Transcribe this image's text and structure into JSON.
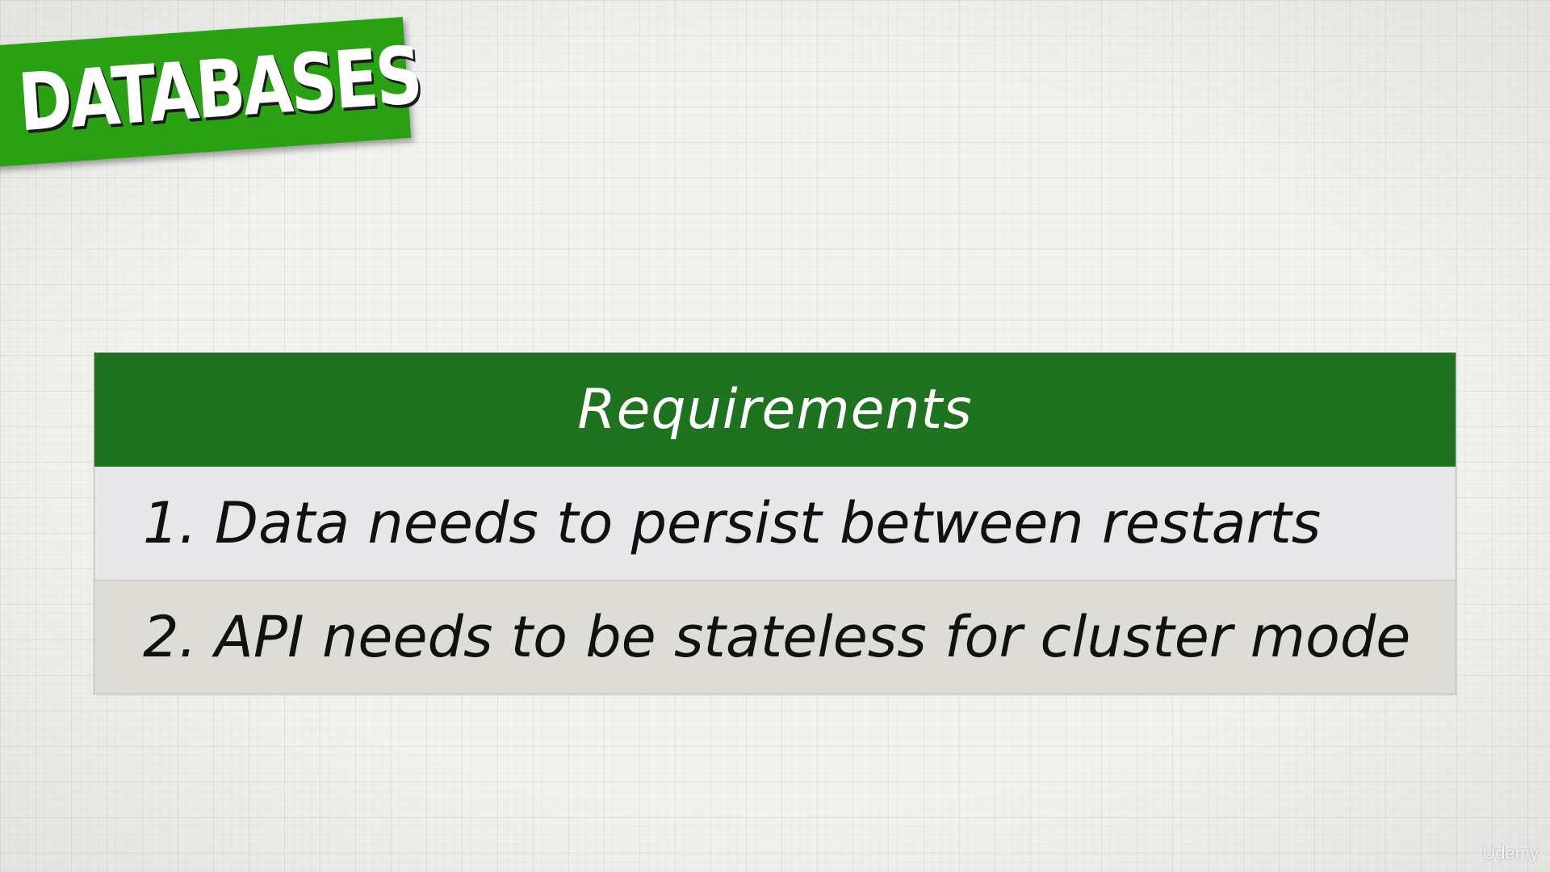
{
  "banner": {
    "title": "DATABASES",
    "color": "#2aa013"
  },
  "requirements": {
    "header": "Requirements",
    "header_color": "#1e7220",
    "items": [
      "1. Data needs to persist between restarts",
      "2. API needs to be stateless for cluster mode"
    ]
  },
  "watermark": {
    "text": "Udemy"
  }
}
